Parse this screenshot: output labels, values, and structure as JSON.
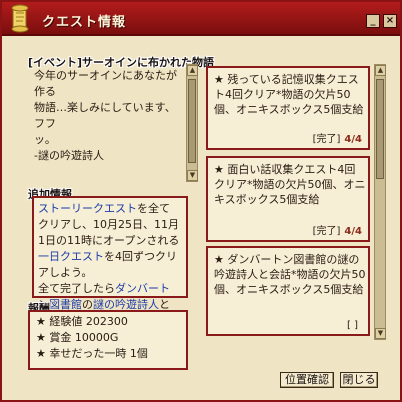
{
  "window": {
    "title": "クエスト情報"
  },
  "story": {
    "label": "[イベント]サーオインに布かれた物語",
    "body": "今年のサーオインにあなたが作る\n物語…楽しみにしています、フフ\nッ。\n-謎の吟遊詩人"
  },
  "additional_info": {
    "label": "追加情報",
    "segments": [
      {
        "text": "ストーリークエスト",
        "link": true
      },
      {
        "text": "を全てクリアし、10月25日、11月1日の11時にオープンされる",
        "link": false
      },
      {
        "text": "一日クエスト",
        "link": true
      },
      {
        "text": "を4回ずつクリアしよう。\n全て完了したら",
        "link": false
      },
      {
        "text": "ダンバートン図書館",
        "link": true
      },
      {
        "text": "の",
        "link": false
      },
      {
        "text": "謎の吟遊詩人",
        "link": true
      },
      {
        "text": "と会話しよう。",
        "link": false
      }
    ]
  },
  "rewards": {
    "label": "報酬",
    "items": [
      "★ 経験値 202300",
      "★ 賞金 10000G",
      "★ 幸せだった一時 1個"
    ]
  },
  "quests": [
    {
      "text": "★ 残っている記憶収集クエスト4回クリア*物語の欠片50個、オニキスボックス5個支給",
      "status": "[完了]",
      "count": "4/4"
    },
    {
      "text": "★ 面白い話収集クエスト4回クリア*物語の欠片50個、オニキスボックス5個支給",
      "status": "[完了]",
      "count": "4/4"
    },
    {
      "text": "★ ダンバートン図書館の謎の吟遊詩人と会話*物語の欠片50個、オニキスボックス5個支給",
      "status": "[ ]",
      "count": ""
    }
  ],
  "buttons": {
    "locate": "位置確認",
    "close": "閉じる"
  },
  "colors": {
    "title_bar": "#9a1616",
    "panel_border": "#8a1a1a",
    "background": "#efe5c4",
    "link": "#1a3aa8"
  }
}
